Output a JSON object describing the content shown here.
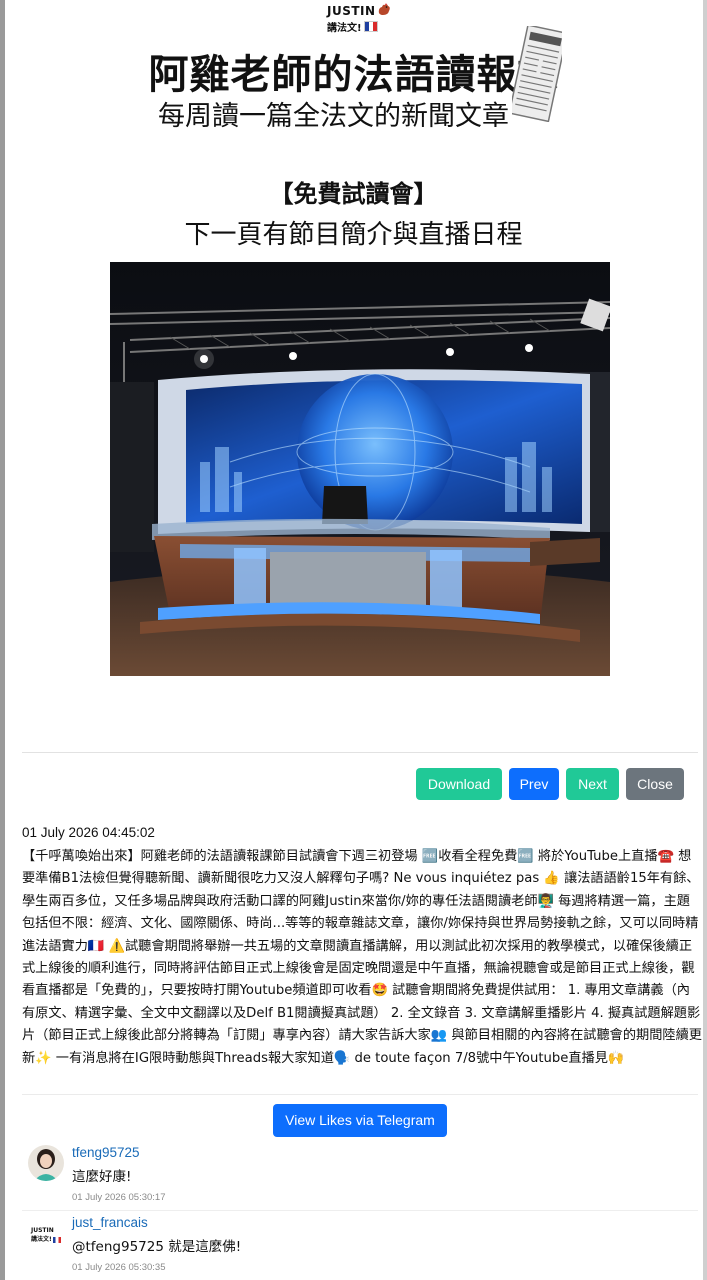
{
  "header": {
    "brand_name": "JUSTIN",
    "brand_sub": "講法文!",
    "title_main": "阿雞老師的法語讀報課",
    "title_sub": "每周讀一篇全法文的新聞文章"
  },
  "headline": {
    "line1": "【免費試讀會】",
    "line2": "下一頁有節目簡介與直播日程"
  },
  "buttons": {
    "download": "Download",
    "prev": "Prev",
    "next": "Next",
    "close": "Close",
    "telegram": "View Likes via Telegram"
  },
  "post": {
    "date": "01 July 2026 04:45:02",
    "body": "【千呼萬喚始出來】阿雞老師的法語讀報課節目試讀會下週三初登場 🆓收看全程免費🆓 將於YouTube上直播☎️ 想要準備B1法檢但覺得聽新聞、讀新聞很吃力又沒人解釋句子嗎? Ne vous inquiétez pas 👍 讓法語語齡15年有餘、學生兩百多位，又任多場品牌與政府活動口譯的阿雞Justin來當你/妳的專任法語閱讀老師👨‍🏫 每週將精選一篇，主題包括但不限：經濟、文化、國際關係、時尚...等等的報章雜誌文章，讓你/妳保持與世界局勢接軌之餘，又可以同時精進法語實力🇫🇷 ⚠️試聽會期間將舉辦一共五場的文章閱讀直播講解，用以測試此初次採用的教學模式，以確保後續正式上線後的順利進行，同時將評估節目正式上線後會是固定晚間還是中午直播，無論視聽會或是節目正式上線後，觀看直播都是「免費的」，只要按時打開Youtube頻道即可收看🤩 試聽會期間將免費提供試用： 1. 專用文章講義（內有原文、精選字彙、全文中文翻譯以及Delf B1閱讀擬真試題） 2. 全文錄音 3. 文章講解重播影片 4. 擬真試題解題影片（節目正式上線後此部分將轉為「訂閱」專享內容）請大家告訴大家👥 與節目相關的內容將在試聽會的期間陸續更新✨ 一有消息將在IG限時動態與Threads報大家知道🗣️ de toute façon 7/8號中午Youtube直播見🙌"
  },
  "comments": [
    {
      "user": "tfeng95725",
      "text": "這麼好康!",
      "time": "01 July 2026 05:30:17"
    },
    {
      "user": "just_francais",
      "text": "@tfeng95725 就是這麼佛!",
      "time": "01 July 2026 05:30:35",
      "avatar_brand": "JUSTIN",
      "avatar_sub": "講法文!"
    }
  ]
}
